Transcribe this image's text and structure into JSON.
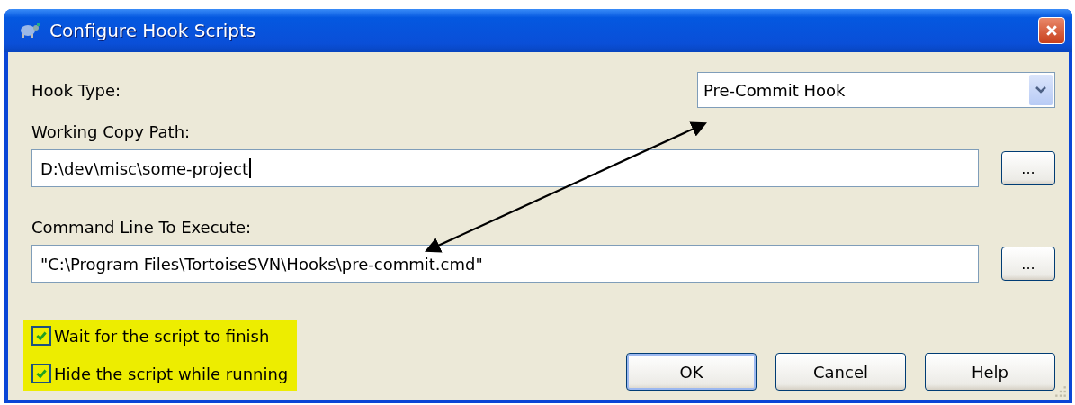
{
  "window": {
    "title": "Configure Hook Scripts"
  },
  "hook_type": {
    "label": "Hook Type:",
    "value": "Pre-Commit Hook"
  },
  "working_copy_path": {
    "label": "Working Copy Path:",
    "value": "D:\\dev\\misc\\some-project",
    "focused": true,
    "browse": "..."
  },
  "command_line": {
    "label": "Command Line To Execute:",
    "value": "\"C:\\Program Files\\TortoiseSVN\\Hooks\\pre-commit.cmd\"",
    "focused": false,
    "browse": "..."
  },
  "options": {
    "highlighted": true,
    "items": [
      {
        "label": "Wait for the script to finish",
        "checked": true
      },
      {
        "label": "Hide the script while running",
        "checked": true
      }
    ]
  },
  "buttons": [
    {
      "label": "OK",
      "default": true
    },
    {
      "label": "Cancel",
      "default": false
    },
    {
      "label": "Help",
      "default": false
    }
  ]
}
